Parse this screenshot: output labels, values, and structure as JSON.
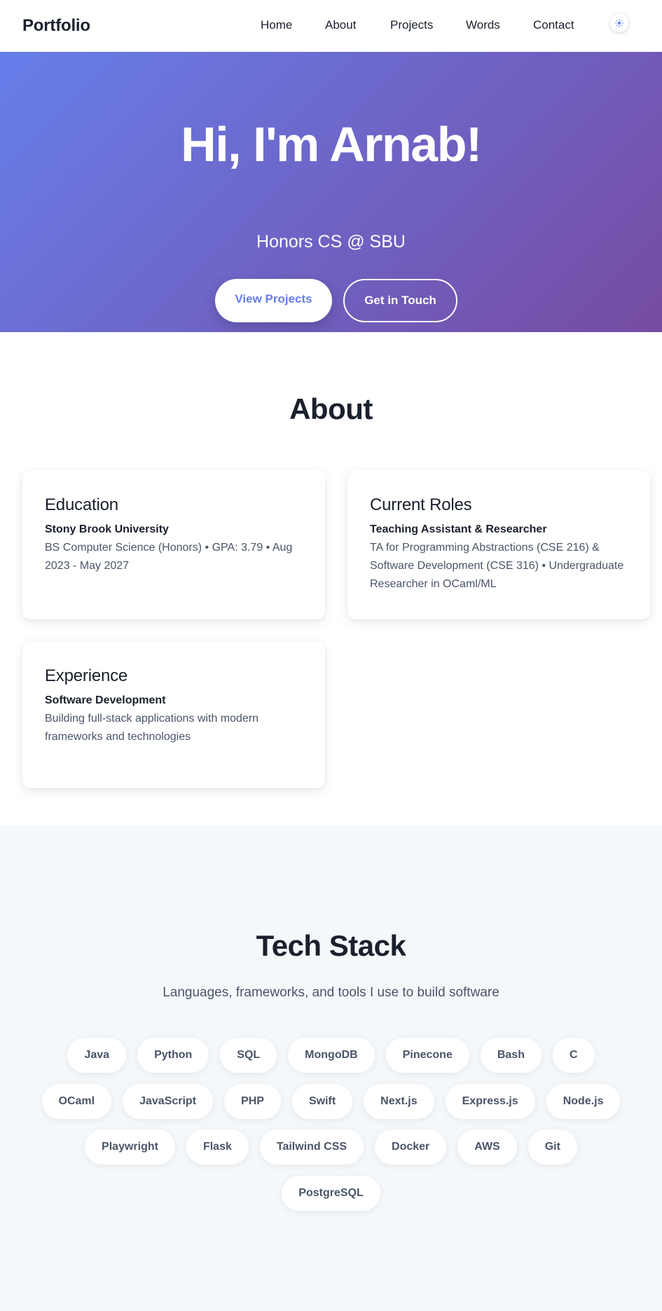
{
  "nav": {
    "brand": "Portfolio",
    "links": [
      "Home",
      "About",
      "Projects",
      "Words",
      "Contact"
    ],
    "theme_icon": "sun-icon"
  },
  "hero": {
    "title": "Hi, I'm Arnab!",
    "subtitle": "Honors CS @ SBU",
    "primary_button": "View Projects",
    "secondary_button": "Get in Touch"
  },
  "about": {
    "title": "About",
    "cards": [
      {
        "title": "Education",
        "subtitle": "Stony Brook University",
        "text": "BS Computer Science (Honors) • GPA: 3.79 • Aug 2023 - May 2027"
      },
      {
        "title": "Current Roles",
        "subtitle": "Teaching Assistant & Researcher",
        "text": "TA for Programming Abstractions (CSE 216) & Software Development (CSE 316) • Undergraduate Researcher in OCaml/ML"
      },
      {
        "title": "Experience",
        "subtitle": "Software Development",
        "text": "Building full-stack applications with modern frameworks and technologies"
      }
    ]
  },
  "tech": {
    "title": "Tech Stack",
    "subtitle": "Languages, frameworks, and tools I use to build software",
    "rows": [
      [
        "Java",
        "Python",
        "SQL",
        "MongoDB",
        "Pinecone",
        "Bash",
        "C"
      ],
      [
        "OCaml",
        "JavaScript",
        "PHP",
        "Swift",
        "Next.js",
        "Express.js",
        "Node.js"
      ],
      [
        "Playwright",
        "Flask",
        "Tailwind CSS",
        "Docker",
        "AWS",
        "Git"
      ],
      [
        "PostgreSQL"
      ]
    ]
  },
  "colors": {
    "gradient_start": "#667eea",
    "gradient_end": "#764ba2",
    "text_dark": "#1a202c",
    "text_muted": "#4a5568",
    "tech_bg": "#f5f8fb"
  }
}
